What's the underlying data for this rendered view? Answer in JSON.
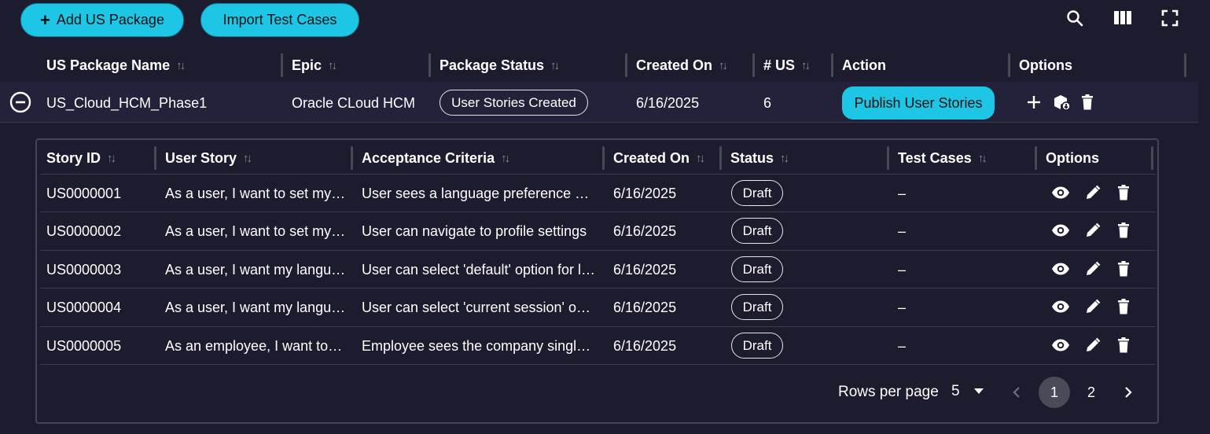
{
  "toolbar": {
    "add_label": "Add US Package",
    "import_label": "Import Test Cases"
  },
  "packages_table": {
    "columns": [
      "US Package Name",
      "Epic",
      "Package Status",
      "Created On",
      "# US",
      "Action",
      "Options"
    ],
    "row": {
      "name": "US_Cloud_HCM_Phase1",
      "epic": "Oracle CLoud HCM",
      "status": "User Stories Created",
      "created_on": "6/16/2025",
      "us_count": "6",
      "action_label": "Publish User Stories"
    }
  },
  "stories_table": {
    "columns": [
      "Story ID",
      "User Story",
      "Acceptance Criteria",
      "Created On",
      "Status",
      "Test Cases",
      "Options"
    ],
    "rows": [
      {
        "id": "US0000001",
        "story": "As a user, I want to set my language preference",
        "criteria": "User sees a language preference dropdown",
        "created_on": "6/16/2025",
        "status": "Draft",
        "test_cases": "–"
      },
      {
        "id": "US0000002",
        "story": "As a user, I want to set my language preference",
        "criteria": "User can navigate to profile settings",
        "created_on": "6/16/2025",
        "status": "Draft",
        "test_cases": "–"
      },
      {
        "id": "US0000003",
        "story": "As a user, I want my language preference",
        "criteria": "User can select 'default' option for language",
        "created_on": "6/16/2025",
        "status": "Draft",
        "test_cases": "–"
      },
      {
        "id": "US0000004",
        "story": "As a user, I want my language preference",
        "criteria": "User can select 'current session' option",
        "created_on": "6/16/2025",
        "status": "Draft",
        "test_cases": "–"
      },
      {
        "id": "US0000005",
        "story": "As an employee, I want to use single sign-on",
        "criteria": "Employee sees the company single sign-on",
        "created_on": "6/16/2025",
        "status": "Draft",
        "test_cases": "–"
      }
    ]
  },
  "pagination": {
    "rows_per_page_label": "Rows per page",
    "rows_per_page_value": "5",
    "pages": [
      "1",
      "2"
    ],
    "current_page": "1"
  },
  "colors": {
    "background": "#1d1b2e",
    "accent": "#1ec6e6",
    "row_bg": "#24223a"
  }
}
